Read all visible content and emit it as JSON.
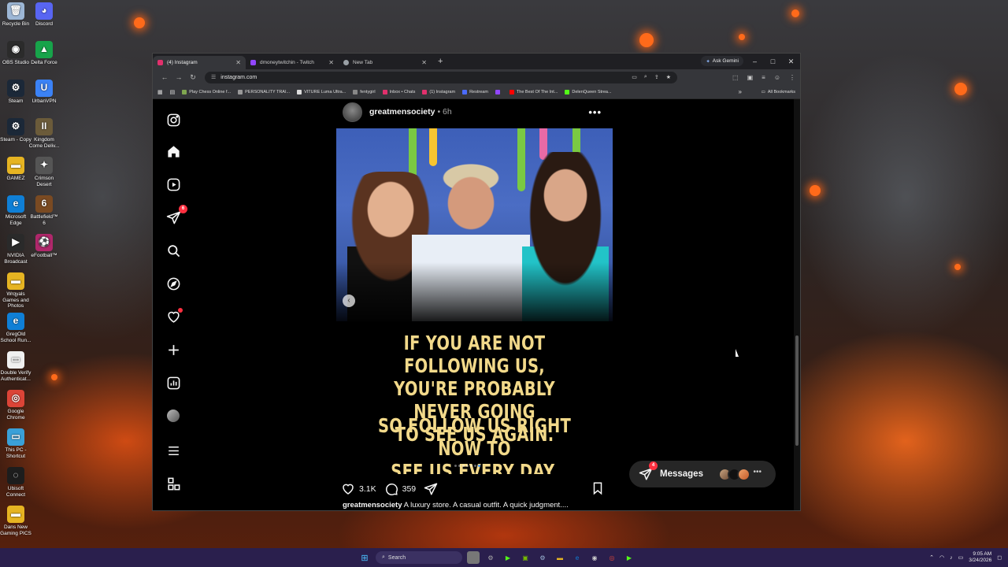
{
  "desktop": {
    "icons": [
      {
        "label": "Recycle Bin",
        "glyph": "🗑",
        "color": "#9db7d6"
      },
      {
        "label": "Discord",
        "glyph": "◕",
        "color": "#5865f2"
      },
      {
        "label": "OBS Studio",
        "glyph": "◉",
        "color": "#2b2b2b"
      },
      {
        "label": "Delta Force",
        "glyph": "▲",
        "color": "#17a34a"
      },
      {
        "label": "Steam",
        "glyph": "⚙",
        "color": "#1b2838"
      },
      {
        "label": "UrbanVPN",
        "glyph": "U",
        "color": "#3b82f6"
      },
      {
        "label": "Steam - Copy",
        "glyph": "⚙",
        "color": "#1b2838"
      },
      {
        "label": "Kingdom Come Deliv...",
        "glyph": "II",
        "color": "#6b5b3a"
      },
      {
        "label": "GAMEZ",
        "glyph": "▬",
        "color": "#e6b422"
      },
      {
        "label": "Crimson Desert",
        "glyph": "✦",
        "color": "#555555"
      },
      {
        "label": "Microsoft Edge",
        "glyph": "e",
        "color": "#0f7fd6"
      },
      {
        "label": "Battlefield™ 6",
        "glyph": "6",
        "color": "#7a4a22"
      },
      {
        "label": "NVIDIA Broadcast",
        "glyph": "▶",
        "color": "#2a2a2a"
      },
      {
        "label": "eFootball™",
        "glyph": "⚽",
        "color": "#b0276b"
      },
      {
        "label": "Wrqyals Games and Photos",
        "glyph": "▬",
        "color": "#e6b422"
      },
      {
        "label": "GregOld School Run...",
        "glyph": "e",
        "color": "#0f7fd6"
      },
      {
        "label": "Double Verify Authenticat...",
        "glyph": "▭",
        "color": "#f0f0f0"
      },
      {
        "label": "Google Chrome",
        "glyph": "◎",
        "color": "#db4437"
      },
      {
        "label": "This PC - Shortcut",
        "glyph": "▭",
        "color": "#3aa0d8"
      },
      {
        "label": "Ubisoft Connect",
        "glyph": "◌",
        "color": "#1d1d1d"
      },
      {
        "label": "Dans New Gaming PICS",
        "glyph": "▬",
        "color": "#e6b422"
      }
    ]
  },
  "browser": {
    "tabs": [
      {
        "title": "(4) Instagram",
        "color": "#e1306c",
        "active": true
      },
      {
        "title": "dmoneytwitchin - Twitch",
        "color": "#9146ff",
        "active": false
      },
      {
        "title": "New Tab",
        "color": "#9aa0a6",
        "active": false
      }
    ],
    "new_tab": "+",
    "gemini_label": "Ask Gemini",
    "window_controls": {
      "minimize": "–",
      "maximize": "□",
      "close": "✕"
    },
    "nav": {
      "back": "←",
      "forward": "→",
      "reload": "↻"
    },
    "url": "instagram.com",
    "bookmarks": [
      {
        "label": "Play Chess Online f...",
        "color": "#7fa650"
      },
      {
        "label": "PERSONALITY TRAI...",
        "color": "#999999"
      },
      {
        "label": "VITURE Luma Ultra...",
        "color": "#dddddd"
      },
      {
        "label": "fentygirl",
        "color": "#888888"
      },
      {
        "label": "Inbox • Chats",
        "color": "#e1306c"
      },
      {
        "label": "(1) Instagram",
        "color": "#e1306c"
      },
      {
        "label": "Restream",
        "color": "#4b6bfb"
      },
      {
        "label": "",
        "color": "#9146ff"
      },
      {
        "label": "The Best Of The Int...",
        "color": "#ff0000"
      },
      {
        "label": "DelenQueen Strea...",
        "color": "#53fc18"
      }
    ],
    "bookmarks_more": "»",
    "all_bookmarks": "All Bookmarks"
  },
  "instagram": {
    "notifications_badge": "6",
    "post": {
      "username": "greatmensociety",
      "time": "• 6h",
      "more": "•••",
      "overlay_line1": [
        "IF YOU ARE NOT FOLLOWING US,",
        "YOU'RE PROBABLY NEVER GOING",
        "TO SEE US AGAIN."
      ],
      "overlay_line2": [
        "SO FOLLOW US RIGHT NOW TO",
        "SEE US EVERY DAY."
      ],
      "likes": "3.1K",
      "comments": "359",
      "caption_user": "greatmensociety",
      "caption_text": " A luxury store. A casual outfit. A quick judgment...."
    },
    "messages": {
      "label": "Messages",
      "badge": "4",
      "more": "•••"
    }
  },
  "taskbar": {
    "search_placeholder": "Search",
    "time": "9:05 AM",
    "date": "3/24/2026"
  }
}
